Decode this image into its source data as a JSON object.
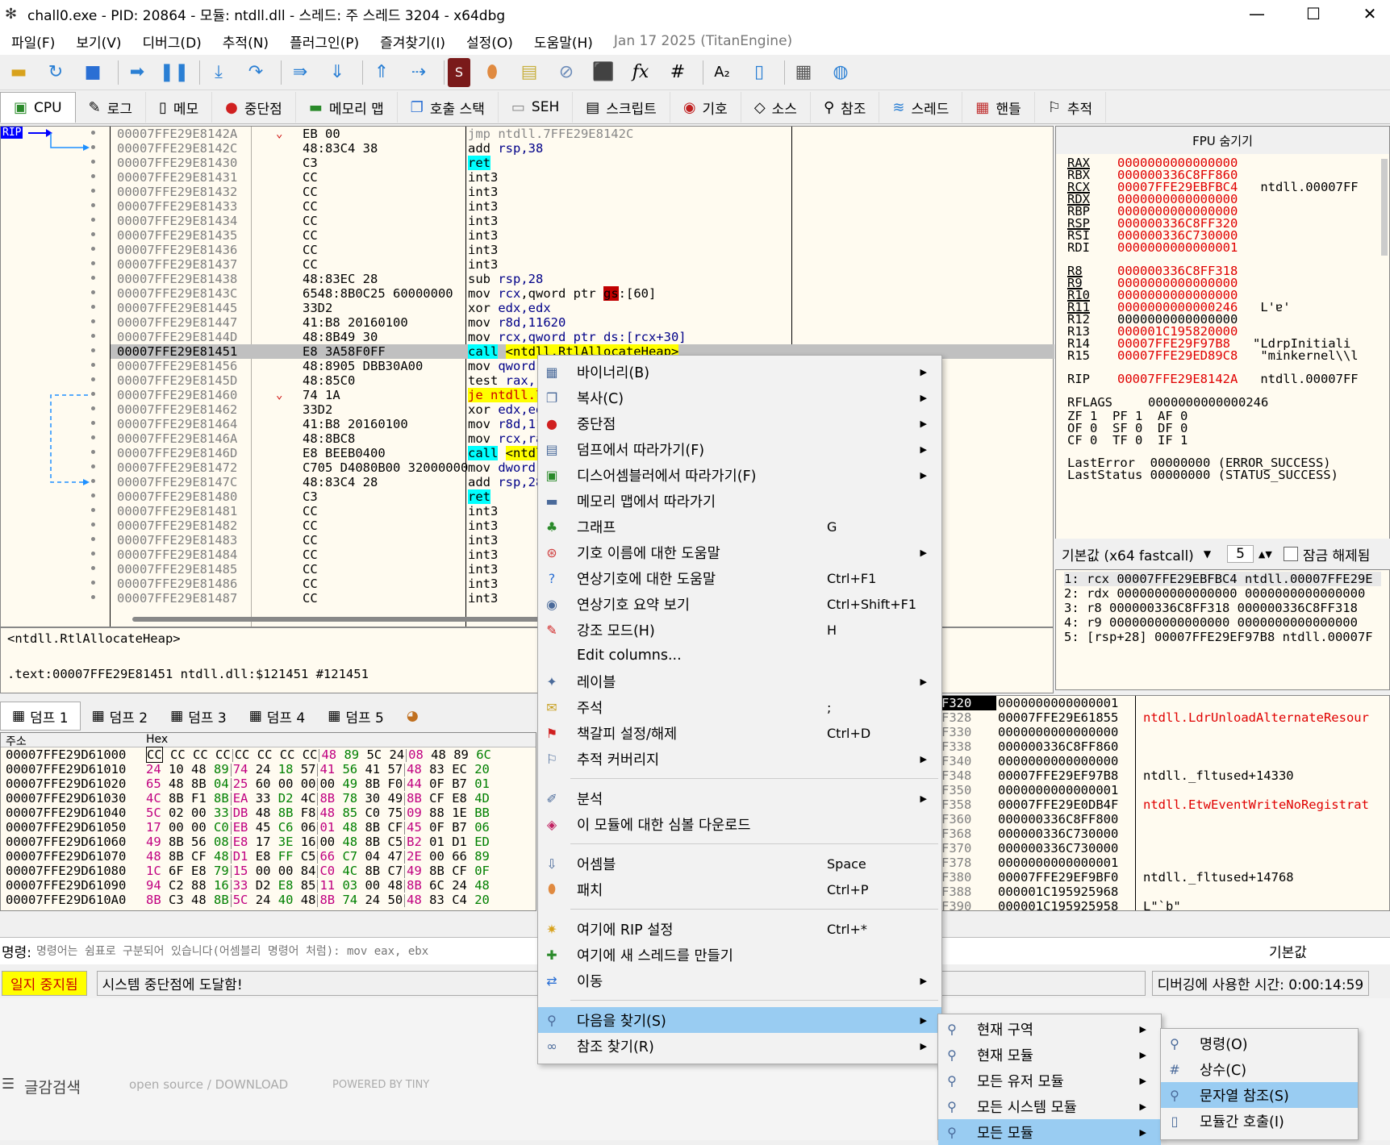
{
  "window": {
    "title": "chall0.exe - PID: 20864 - 모듈: ntdll.dll - 스레드: 주 스레드 3204 - x64dbg"
  },
  "menubar": {
    "items": [
      "파일(F)",
      "보기(V)",
      "디버그(D)",
      "추적(N)",
      "플러그인(P)",
      "즐겨찾기(I)",
      "설정(O)",
      "도움말(H)"
    ],
    "date": "Jan 17 2025 (TitanEngine)"
  },
  "tabs": [
    {
      "label": "CPU"
    },
    {
      "label": "로그"
    },
    {
      "label": "메모"
    },
    {
      "label": "중단점"
    },
    {
      "label": "메모리 맵"
    },
    {
      "label": "호출 스택"
    },
    {
      "label": "SEH"
    },
    {
      "label": "스크립트"
    },
    {
      "label": "기호"
    },
    {
      "label": "소스"
    },
    {
      "label": "참조"
    },
    {
      "label": "스레드"
    },
    {
      "label": "핸들"
    },
    {
      "label": "추적"
    }
  ],
  "cpu": {
    "rip_label": "RIP",
    "rows": [
      {
        "addr": "00007FFE29E8142A",
        "bytes": "EB 00",
        "arrow": "⌄",
        "dis": "jmp ntdll.7FFE29E8142C",
        "kind": "jmp"
      },
      {
        "addr": "00007FFE29E8142C",
        "bytes": "48:83C4 38",
        "dis": "add rsp,38"
      },
      {
        "addr": "00007FFE29E81430",
        "bytes": "C3",
        "dis": "ret",
        "kind": "ret"
      },
      {
        "addr": "00007FFE29E81431",
        "bytes": "CC",
        "dis": "int3"
      },
      {
        "addr": "00007FFE29E81432",
        "bytes": "CC",
        "dis": "int3"
      },
      {
        "addr": "00007FFE29E81433",
        "bytes": "CC",
        "dis": "int3"
      },
      {
        "addr": "00007FFE29E81434",
        "bytes": "CC",
        "dis": "int3"
      },
      {
        "addr": "00007FFE29E81435",
        "bytes": "CC",
        "dis": "int3"
      },
      {
        "addr": "00007FFE29E81436",
        "bytes": "CC",
        "dis": "int3"
      },
      {
        "addr": "00007FFE29E81437",
        "bytes": "CC",
        "dis": "int3"
      },
      {
        "addr": "00007FFE29E81438",
        "bytes": "48:83EC 28",
        "dis": "sub rsp,28"
      },
      {
        "addr": "00007FFE29E8143C",
        "bytes": "6548:8B0C25 60000000",
        "dis": "mov rcx,qword ptr gs:[60]",
        "kind": "gs"
      },
      {
        "addr": "00007FFE29E81445",
        "bytes": "33D2",
        "dis": "xor edx,edx"
      },
      {
        "addr": "00007FFE29E81447",
        "bytes": "41:B8 20160100",
        "dis": "mov r8d,11620"
      },
      {
        "addr": "00007FFE29E8144D",
        "bytes": "48:8B49 30",
        "dis": "mov rcx,qword ptr ds:[rcx+30]"
      },
      {
        "addr": "00007FFE29E81451",
        "bytes": "E8 3A58F0FF",
        "dis": "call <ntdll.RtlAllocateHeap>",
        "kind": "call",
        "sel": true
      },
      {
        "addr": "00007FFE29E81456",
        "bytes": "48:8905 DBB30A00",
        "dis": "mov qword ptr ds:[<&ntdll.lpJit...>],rax"
      },
      {
        "addr": "00007FFE29E8145D",
        "bytes": "48:85C0",
        "dis": "test rax,rax"
      },
      {
        "addr": "00007FFE29E81460",
        "bytes": "74 1A",
        "arrow": "⌄",
        "dis": "je ntdll.7FFE29E8147C",
        "kind": "je"
      },
      {
        "addr": "00007FFE29E81462",
        "bytes": "33D2",
        "dis": "xor edx,edx"
      },
      {
        "addr": "00007FFE29E81464",
        "bytes": "41:B8 20160100",
        "dis": "mov r8d,11620"
      },
      {
        "addr": "00007FFE29E8146A",
        "bytes": "48:8BC8",
        "dis": "mov rcx,rax"
      },
      {
        "addr": "00007FFE29E8146D",
        "bytes": "E8 BEEB0400",
        "dis": "call <ntdll.memset>",
        "kind": "call2"
      },
      {
        "addr": "00007FFE29E81472",
        "bytes": "C705 D4080B00 32000000",
        "dis": "mov dword ptr ds:[7FFE29F31D50],32"
      },
      {
        "addr": "00007FFE29E8147C",
        "bytes": "48:83C4 28",
        "dis": "add rsp,28"
      },
      {
        "addr": "00007FFE29E81480",
        "bytes": "C3",
        "dis": "ret",
        "kind": "ret"
      },
      {
        "addr": "00007FFE29E81481",
        "bytes": "CC",
        "dis": "int3"
      },
      {
        "addr": "00007FFE29E81482",
        "bytes": "CC",
        "dis": "int3"
      },
      {
        "addr": "00007FFE29E81483",
        "bytes": "CC",
        "dis": "int3"
      },
      {
        "addr": "00007FFE29E81484",
        "bytes": "CC",
        "dis": "int3"
      },
      {
        "addr": "00007FFE29E81485",
        "bytes": "CC",
        "dis": "int3"
      },
      {
        "addr": "00007FFE29E81486",
        "bytes": "CC",
        "dis": "int3"
      },
      {
        "addr": "00007FFE29E81487",
        "bytes": "CC",
        "dis": "int3"
      }
    ]
  },
  "infobox": {
    "line1": "<ntdll.RtlAllocateHeap>",
    "line2": ".text:00007FFE29E81451 ntdll.dll:$121451 #121451"
  },
  "fpu": {
    "header": "FPU 숨기기",
    "regs": [
      {
        "n": "RAX",
        "v": "0000000000000000",
        "c": ""
      },
      {
        "n": "RBX",
        "v": "000000336C8FF860",
        "c": ""
      },
      {
        "n": "RCX",
        "v": "00007FFE29EBFBC4",
        "c": "ntdll.00007FF"
      },
      {
        "n": "RDX",
        "v": "0000000000000000",
        "c": ""
      },
      {
        "n": "RBP",
        "v": "0000000000000000",
        "c": ""
      },
      {
        "n": "RSP",
        "v": "000000336C8FF320",
        "c": ""
      },
      {
        "n": "RSI",
        "v": "000000336C730000",
        "c": ""
      },
      {
        "n": "RDI",
        "v": "0000000000000001",
        "c": ""
      },
      {
        "n": "R8",
        "v": "000000336C8FF318",
        "c": ""
      },
      {
        "n": "R9",
        "v": "0000000000000000",
        "c": ""
      },
      {
        "n": "R10",
        "v": "0000000000000000",
        "c": ""
      },
      {
        "n": "R11",
        "v": "0000000000000246",
        "c": "L'ɐ'"
      },
      {
        "n": "R12",
        "v": "0000000000000000",
        "c": ""
      },
      {
        "n": "R13",
        "v": "000001C195820000",
        "c": ""
      },
      {
        "n": "R14",
        "v": "00007FFE29F97B8",
        "c": "\"LdrpInitiali"
      },
      {
        "n": "R15",
        "v": "00007FFE29ED89C8",
        "c": "\"minkernel\\\\l"
      },
      {
        "n": "RIP",
        "v": "00007FFE29E8142A",
        "c": "ntdll.00007FF"
      }
    ],
    "rflags_label": "RFLAGS",
    "rflags": "0000000000000246",
    "flags": [
      "ZF 1  PF 1  AF 0",
      "OF 0  SF 0  DF 0",
      "CF 0  TF 0  IF 1"
    ],
    "lasterror": "LastError  00000000 (ERROR_SUCCESS)",
    "laststatus": "LastStatus 00000000 (STATUS_SUCCESS)"
  },
  "callconv": {
    "label": "기본값 (x64 fastcall)",
    "count": "5",
    "unlock": "잠금 해제됨"
  },
  "args": [
    "1: rcx 00007FFE29EBFBC4 ntdll.00007FFE29E",
    "2: rdx 0000000000000000 0000000000000000",
    "3: r8 000000336C8FF318 000000336C8FF318",
    "4: r9 0000000000000000 0000000000000000",
    "5: [rsp+28] 00007FFE29EF97B8 ntdll.00007F"
  ],
  "dumptabs": [
    "덤프 1",
    "덤프 2",
    "덤프 3",
    "덤프 4",
    "덤프 5"
  ],
  "dump": {
    "col_addr": "주소",
    "col_hex": "Hex",
    "rows": [
      {
        "a": "00007FFE29D61000",
        "h": "CC CC CC CC CC CC CC CC 48 89 5C 24 08 48 89 6C"
      },
      {
        "a": "00007FFE29D61010",
        "h": "24 10 48 89 74 24 18 57 41 56 41 57 48 83 EC 20"
      },
      {
        "a": "00007FFE29D61020",
        "h": "65 48 8B 04 25 60 00 00 00 49 8B F0 44 0F B7 01"
      },
      {
        "a": "00007FFE29D61030",
        "h": "4C 8B F1 8B EA 33 D2 4C 8B 78 30 49 8B CF E8 4D"
      },
      {
        "a": "00007FFE29D61040",
        "h": "5C 02 00 33 DB 48 8B F8 48 85 C0 75 09 88 1E BB"
      },
      {
        "a": "00007FFE29D61050",
        "h": "17 00 00 C0 EB 45 C6 06 01 48 8B CF 45 0F B7 06"
      },
      {
        "a": "00007FFE29D61060",
        "h": "49 8B 56 08 E8 17 3E 16 00 48 8B C5 B2 01 D1 ED"
      },
      {
        "a": "00007FFE29D61070",
        "h": "48 8B CF 48 D1 E8 FF C5 66 C7 04 47 2E 00 66 89"
      },
      {
        "a": "00007FFE29D61080",
        "h": "1C 6F E8 79 15 00 00 84 C0 4C 8B C7 49 8B CF 0F"
      },
      {
        "a": "00007FFE29D61090",
        "h": "94 C2 88 16 33 D2 E8 85 11 03 00 48 8B 6C 24 48"
      },
      {
        "a": "00007FFE29D610A0",
        "h": "8B C3 48 8B 5C 24 40 48 8B 74 24 50 48 83 C4 20"
      }
    ]
  },
  "stack": {
    "rows": [
      {
        "a": "F320",
        "v": "0000000000000001",
        "c": "",
        "red": false
      },
      {
        "a": "F328",
        "v": "00007FFE29E61855",
        "c": "ntdll.LdrUnloadAlternateResour",
        "red": true
      },
      {
        "a": "F330",
        "v": "0000000000000000",
        "c": "",
        "red": false
      },
      {
        "a": "F338",
        "v": "000000336C8FF860",
        "c": "",
        "red": false
      },
      {
        "a": "F340",
        "v": "0000000000000000",
        "c": "",
        "red": false
      },
      {
        "a": "F348",
        "v": "00007FFE29EF97B8",
        "c": "ntdll._fltused+14330",
        "red": false
      },
      {
        "a": "F350",
        "v": "0000000000000001",
        "c": "",
        "red": false
      },
      {
        "a": "F358",
        "v": "00007FFE29E0DB4F",
        "c": "ntdll.EtwEventWriteNoRegistrat",
        "red": true
      },
      {
        "a": "F360",
        "v": "000000336C8FF800",
        "c": "",
        "red": false
      },
      {
        "a": "F368",
        "v": "000000336C730000",
        "c": "",
        "red": false
      },
      {
        "a": "F370",
        "v": "000000336C730000",
        "c": "",
        "red": false
      },
      {
        "a": "F378",
        "v": "0000000000000001",
        "c": "",
        "red": false
      },
      {
        "a": "F380",
        "v": "00007FFE29EF9BF0",
        "c": "ntdll._fltused+14768",
        "red": false
      },
      {
        "a": "F388",
        "v": "000001C195925968",
        "c": "",
        "red": false
      },
      {
        "a": "F390",
        "v": "000001C195925958",
        "c": "L\"`b\"",
        "red": false
      }
    ]
  },
  "cmd": {
    "label": "명령:",
    "placeholder": "명령어는 쉼표로 구분되어 있습니다(어셈블리 명령어 처럼): mov eax, ebx",
    "right": "기본값"
  },
  "status": {
    "paused": "일지 중지됨",
    "message": "시스템 중단점에 도달함!",
    "time": "디버깅에 사용한 시간: 0:00:14:59"
  },
  "footer": {
    "search": "글감검색",
    "open": "open source / DOWNLOAD",
    "powered": "POWERED BY TINY"
  },
  "ctxmenu": [
    {
      "label": "바이너리(B)",
      "sc": "",
      "sub": true,
      "icon": "binary-icon"
    },
    {
      "label": "복사(C)",
      "sc": "",
      "sub": true,
      "icon": "copy-icon"
    },
    {
      "label": "중단점",
      "sc": "",
      "sub": true,
      "icon": "breakpoint-icon"
    },
    {
      "label": "덤프에서 따라가기(F)",
      "sc": "",
      "sub": true,
      "icon": "dump-icon"
    },
    {
      "label": "디스어셈블러에서 따라가기(F)",
      "sc": "",
      "sub": true,
      "icon": "disasm-icon"
    },
    {
      "label": "메모리 맵에서 따라가기",
      "sc": "",
      "sub": false,
      "icon": "memmap-icon"
    },
    {
      "label": "그래프",
      "sc": "G",
      "sub": false,
      "icon": "graph-icon"
    },
    {
      "label": "기호 이름에 대한 도움말",
      "sc": "",
      "sub": true,
      "icon": "help-icon"
    },
    {
      "label": "연상기호에 대한 도움말",
      "sc": "Ctrl+F1",
      "sub": false,
      "icon": "help2-icon"
    },
    {
      "label": "연상기호 요약 보기",
      "sc": "Ctrl+Shift+F1",
      "sub": false,
      "icon": "summary-icon"
    },
    {
      "label": "강조 모드(H)",
      "sc": "H",
      "sub": false,
      "icon": "highlight-icon"
    },
    {
      "label": "Edit columns...",
      "sc": "",
      "sub": false,
      "icon": ""
    },
    {
      "label": "레이블",
      "sc": "",
      "sub": true,
      "icon": "label-icon"
    },
    {
      "label": "주석",
      "sc": ";",
      "sub": false,
      "icon": "comment-icon"
    },
    {
      "label": "책갈피 설정/해제",
      "sc": "Ctrl+D",
      "sub": false,
      "icon": "bookmark-icon"
    },
    {
      "label": "추적 커버리지",
      "sc": "",
      "sub": true,
      "icon": "trace-icon"
    },
    {
      "sep": true
    },
    {
      "label": "분석",
      "sc": "",
      "sub": true,
      "icon": "analyze-icon"
    },
    {
      "label": "이 모듈에 대한 심볼 다운로드",
      "sc": "",
      "sub": false,
      "icon": "download-icon"
    },
    {
      "sep": true
    },
    {
      "label": "어셈블",
      "sc": "Space",
      "sub": false,
      "icon": "assemble-icon"
    },
    {
      "label": "패치",
      "sc": "Ctrl+P",
      "sub": false,
      "icon": "patch-icon"
    },
    {
      "sep": true
    },
    {
      "label": "여기에 RIP 설정",
      "sc": "Ctrl+*",
      "sub": false,
      "icon": "rip-icon"
    },
    {
      "label": "여기에 새 스레드를 만들기",
      "sc": "",
      "sub": false,
      "icon": "thread-icon"
    },
    {
      "label": "이동",
      "sc": "",
      "sub": true,
      "icon": "goto-icon"
    },
    {
      "sep": true
    },
    {
      "label": "다음을 찾기(S)",
      "sc": "",
      "sub": true,
      "icon": "search-icon",
      "hl": true
    },
    {
      "label": "참조 찾기(R)",
      "sc": "",
      "sub": true,
      "icon": "binoculars-icon"
    }
  ],
  "submenu1": [
    {
      "label": "현재 구역",
      "hl": false
    },
    {
      "label": "현재 모듈",
      "hl": false
    },
    {
      "label": "모든 유저 모듈",
      "hl": false
    },
    {
      "label": "모든 시스템 모듈",
      "hl": false
    },
    {
      "label": "모든 모듈",
      "hl": true
    }
  ],
  "submenu2": [
    {
      "label": "명령(O)",
      "hl": false
    },
    {
      "label": "상수(C)",
      "hl": false
    },
    {
      "label": "문자열 참조(S)",
      "hl": true
    },
    {
      "label": "모듈간 호출(I)",
      "hl": false
    }
  ]
}
